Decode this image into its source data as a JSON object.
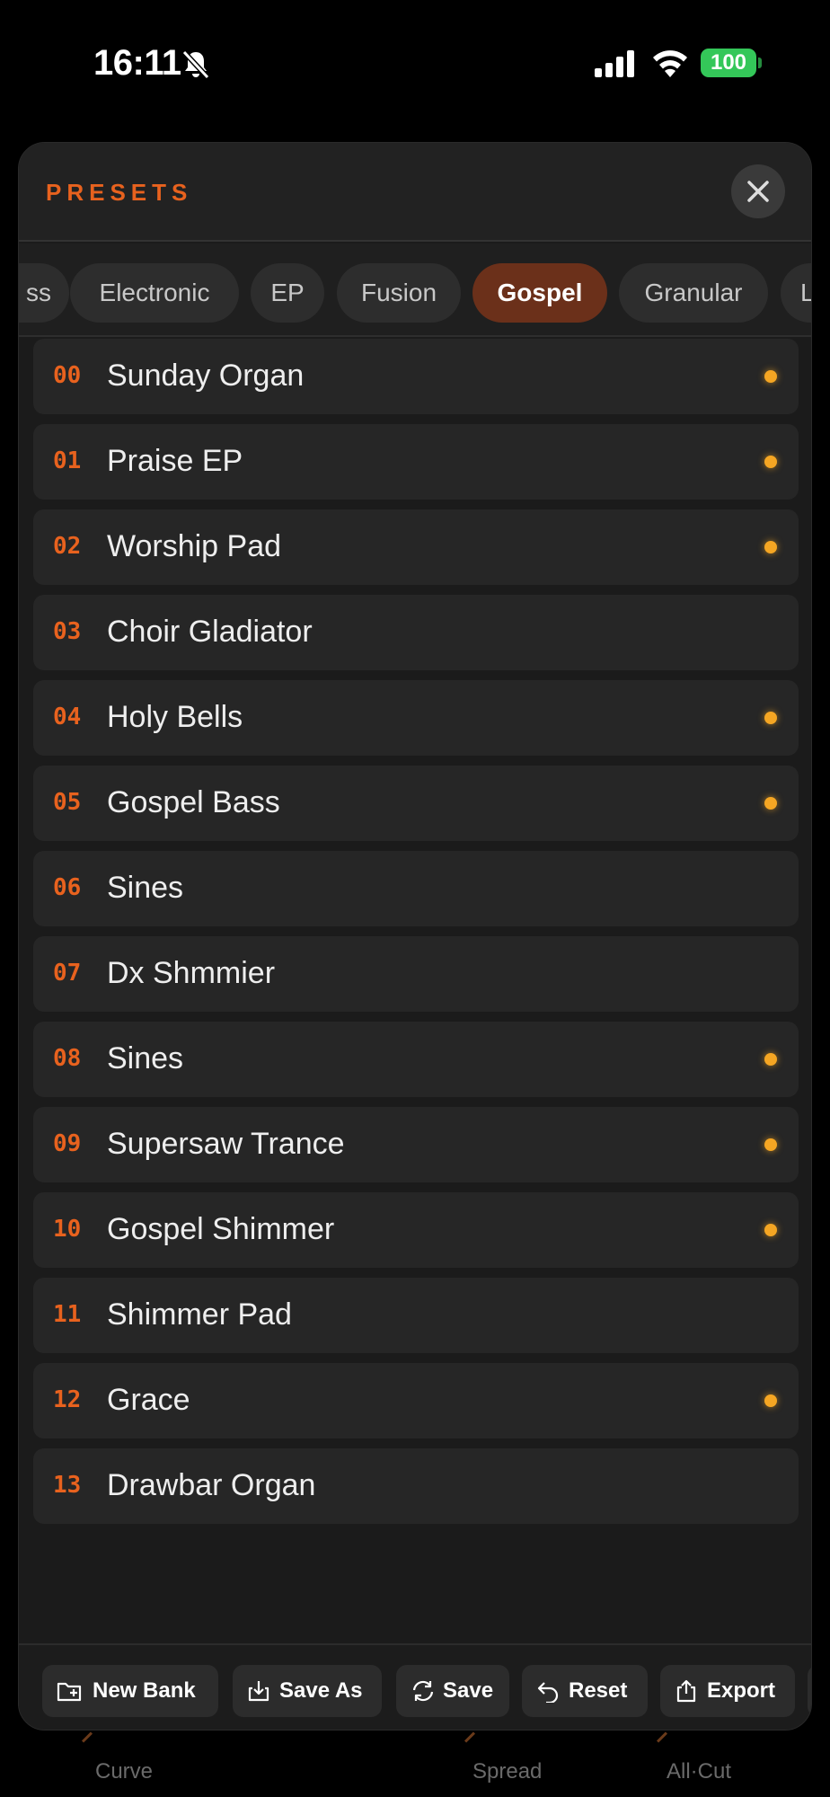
{
  "status_bar": {
    "time": "16:11",
    "battery": "100",
    "icons": [
      "bell-muted-icon",
      "signal-icon",
      "wifi-icon",
      "battery-icon"
    ]
  },
  "background": {
    "labels": [
      "Curve",
      "Spread",
      "All·Cut"
    ]
  },
  "modal": {
    "title": "PRESETS",
    "close_icon": "close-icon"
  },
  "tabs": [
    {
      "label": "ss",
      "active": false
    },
    {
      "label": "Electronic",
      "active": false
    },
    {
      "label": "EP",
      "active": false
    },
    {
      "label": "Fusion",
      "active": false
    },
    {
      "label": "Gospel",
      "active": true
    },
    {
      "label": "Granular",
      "active": false
    },
    {
      "label": "L",
      "active": false
    }
  ],
  "presets": [
    {
      "num": "00",
      "name": "Sunday Organ",
      "dot": true
    },
    {
      "num": "01",
      "name": "Praise EP",
      "dot": true
    },
    {
      "num": "02",
      "name": "Worship Pad",
      "dot": true
    },
    {
      "num": "03",
      "name": "Choir Gladiator",
      "dot": false
    },
    {
      "num": "04",
      "name": "Holy Bells",
      "dot": true
    },
    {
      "num": "05",
      "name": "Gospel Bass",
      "dot": true
    },
    {
      "num": "06",
      "name": "Sines",
      "dot": false
    },
    {
      "num": "07",
      "name": "Dx Shmmier",
      "dot": false
    },
    {
      "num": "08",
      "name": "Sines",
      "dot": true
    },
    {
      "num": "09",
      "name": "Supersaw Trance",
      "dot": true
    },
    {
      "num": "10",
      "name": "Gospel Shimmer",
      "dot": true
    },
    {
      "num": "11",
      "name": "Shimmer Pad",
      "dot": false
    },
    {
      "num": "12",
      "name": "Grace",
      "dot": true
    },
    {
      "num": "13",
      "name": "Drawbar Organ",
      "dot": false
    }
  ],
  "footer": {
    "new_bank": "New Bank",
    "save_as": "Save As",
    "save": "Save",
    "reset": "Reset",
    "export": "Export"
  },
  "colors": {
    "accent": "#e8621e",
    "active_tab": "#6b301a",
    "dot": "#f5a623",
    "battery": "#34c759"
  }
}
